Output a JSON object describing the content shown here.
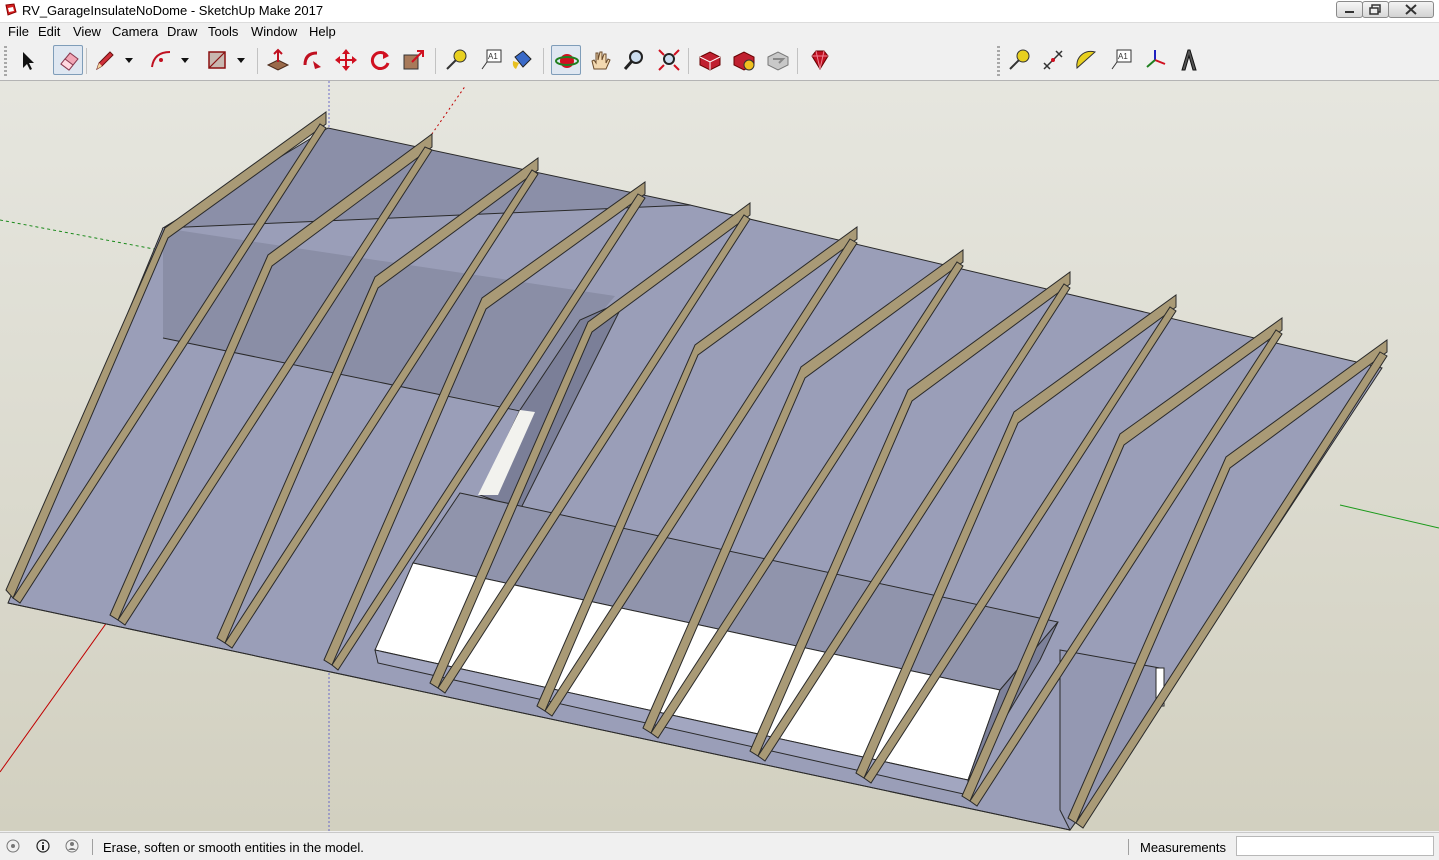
{
  "window": {
    "title": "RV_GarageInsulateNoDome - SketchUp Make 2017"
  },
  "menu": [
    "File",
    "Edit",
    "View",
    "Camera",
    "Draw",
    "Tools",
    "Window",
    "Help"
  ],
  "toolbar": {
    "left_tools": [
      "select-tool",
      "eraser-tool",
      "pencil-tool",
      "arc-tool",
      "rectangle-tool",
      "push-pull-tool",
      "follow-me-tool",
      "move-tool",
      "rotate-tool",
      "scale-tool",
      "tape-measure-tool",
      "text-tool",
      "paint-bucket-tool",
      "orbit-tool",
      "pan-tool",
      "zoom-tool",
      "zoom-extents-tool",
      "3d-warehouse-tool",
      "extension-warehouse-tool",
      "share-component-tool",
      "extension-manager-tool"
    ],
    "right_tools": [
      "tape-measure-tool",
      "dimension-tool",
      "protractor-tool",
      "text-label-tool",
      "axes-tool",
      "3d-text-tool"
    ],
    "active_tool": "eraser-tool"
  },
  "status": {
    "message": "Erase, soften or smooth entities in the model.",
    "measurements_label": "Measurements",
    "measurements_value": ""
  },
  "colors": {
    "sky": "#e4e4dc",
    "ground": "#c9c6b3",
    "face": "#9a9fb8",
    "face_dark": "#878ba3",
    "stud": "#a99a76",
    "insulation": "#ffffff",
    "axis_red": "#c00000",
    "axis_green": "#009000",
    "axis_blue": "#2020c0"
  }
}
